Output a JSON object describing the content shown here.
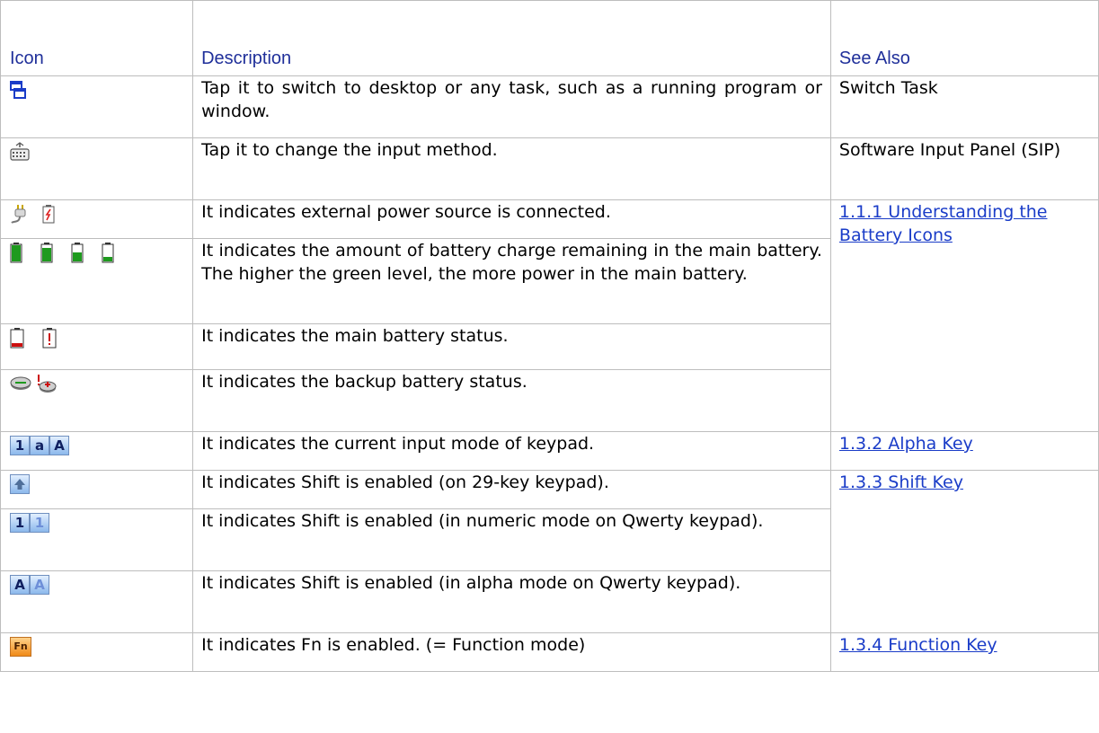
{
  "headers": {
    "icon": "Icon",
    "description": "Description",
    "see_also": "See Also"
  },
  "rows": [
    {
      "icon": "switch-task-icon",
      "description": "Tap it to switch to desktop or any task, such as a running program or window.",
      "see_also": "Switch Task"
    },
    {
      "icon": "keyboard-icon",
      "description": "Tap it to change the input method.",
      "see_also": "Software Input Panel (SIP)"
    },
    {
      "icon": "external-power-icon",
      "description": "It indicates external power source is connected.",
      "see_also": "1.1.1 Understanding the Battery Icons"
    },
    {
      "icon": "battery-level-icons",
      "description": "It indicates the amount of battery charge remaining in the main battery. The higher the green level, the more power in the main battery."
    },
    {
      "icon": "main-battery-status-icons",
      "description": "It indicates the main battery status."
    },
    {
      "icon": "backup-battery-status-icons",
      "description": "It indicates the backup battery status."
    },
    {
      "icon": "input-mode-icons",
      "keys": [
        "1",
        "a",
        "A"
      ],
      "description": "It indicates the current input mode of keypad.",
      "see_also": "1.3.2 Alpha Key"
    },
    {
      "icon": "shift-arrow-icon",
      "description": "It indicates Shift is enabled (on 29-key keypad).",
      "see_also": "1.3.3 Shift Key"
    },
    {
      "icon": "shift-numeric-icons",
      "keys": [
        "1",
        "1"
      ],
      "description": "It indicates Shift is enabled (in numeric mode on Qwerty keypad)."
    },
    {
      "icon": "shift-alpha-icons",
      "keys": [
        "A",
        "A"
      ],
      "description": "It indicates Shift is enabled (in alpha mode on Qwerty keypad)."
    },
    {
      "icon": "fn-key-icon",
      "keys": [
        "Fn"
      ],
      "description": "It indicates Fn is enabled. (= Function mode)",
      "see_also": "1.3.4 Function Key"
    }
  ]
}
